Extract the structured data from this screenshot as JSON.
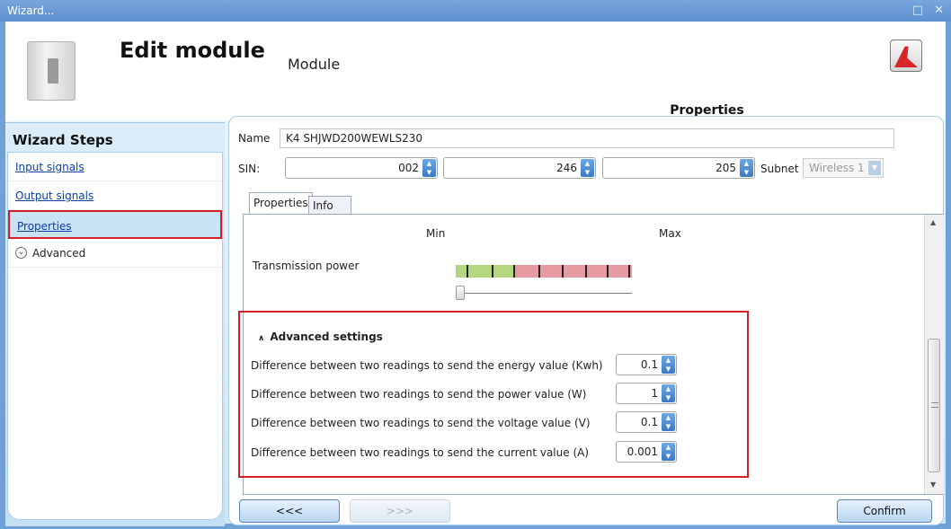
{
  "window": {
    "title": "Wizard...",
    "controls": "□ ✕"
  },
  "header": {
    "title": "Edit module",
    "subtitle": "Module",
    "panel_title": "Properties"
  },
  "wizard": {
    "title": "Wizard Steps",
    "steps": [
      {
        "label": "Input signals"
      },
      {
        "label": "Output signals"
      },
      {
        "label": "Properties"
      },
      {
        "label": "Advanced"
      }
    ]
  },
  "form": {
    "name_label": "Name",
    "name_value": "K4 SHJWD200WEWLS230",
    "sin_label": "SIN:",
    "sin": [
      "002",
      "246",
      "205"
    ],
    "subnet_label": "Subnet",
    "subnet_value": "Wireless 1"
  },
  "tabs": [
    {
      "label": "Properties"
    },
    {
      "label": "Info"
    }
  ],
  "transmission": {
    "min_label": "Min",
    "max_label": "Max",
    "label": "Transmission power",
    "level": 0
  },
  "advanced": {
    "title": "Advanced settings",
    "rows": [
      {
        "label": "Difference between two readings to send the energy value (Kwh)",
        "value": "0.1"
      },
      {
        "label": "Difference between two readings to send the power value (W)",
        "value": "1"
      },
      {
        "label": "Difference between two readings to send the voltage value (V)",
        "value": "0.1"
      },
      {
        "label": "Difference between two readings to send the current value (A)",
        "value": "0.001"
      }
    ]
  },
  "buttons": {
    "back": "<<<",
    "next": ">>>",
    "confirm": "Confirm"
  },
  "colors": {
    "accent_blue": "#3a78c3",
    "highlight_red": "#d4202a",
    "power_green": "#b3d67f",
    "power_red": "#e89aa2"
  }
}
